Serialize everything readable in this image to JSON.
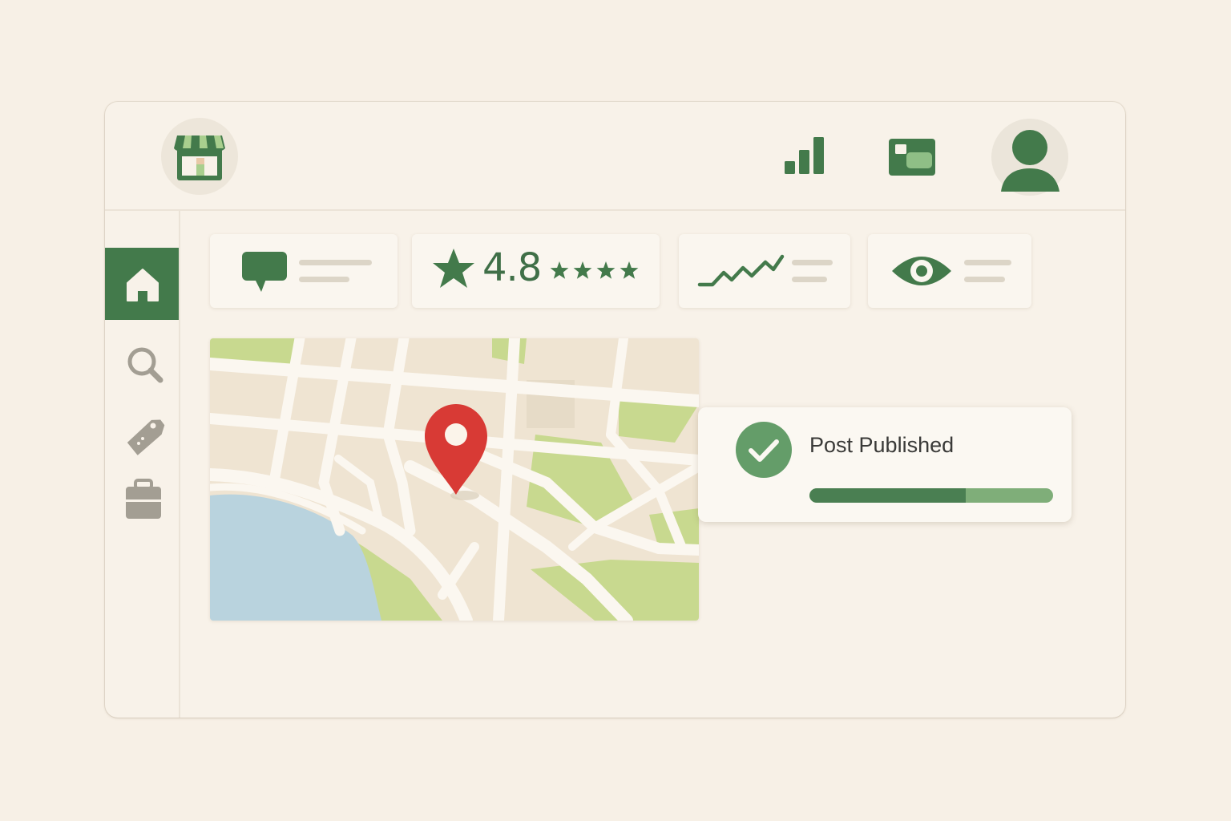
{
  "colors": {
    "accent": "#437a4b",
    "accent_light": "#7fae79",
    "background": "#f7f0e6",
    "map_pin": "#d83a35",
    "water": "#b9d3de",
    "park": "#c8d98f"
  },
  "header": {
    "logo_icon": "storefront-icon",
    "actions": [
      {
        "icon": "bar-chart-icon"
      },
      {
        "icon": "photo-card-icon"
      },
      {
        "icon": "user-avatar-icon"
      }
    ]
  },
  "sidebar": {
    "items": [
      {
        "icon": "home-icon",
        "active": true
      },
      {
        "icon": "search-icon",
        "active": false
      },
      {
        "icon": "tag-icon",
        "active": false
      },
      {
        "icon": "briefcase-icon",
        "active": false
      }
    ]
  },
  "stats": [
    {
      "icon": "speech-bubble-icon"
    },
    {
      "icon": "star-icon",
      "value": "4.8",
      "stars": 4
    },
    {
      "icon": "trend-line-icon"
    },
    {
      "icon": "eye-icon"
    }
  ],
  "map": {
    "pin_icon": "map-pin-icon"
  },
  "toast": {
    "icon": "check-circle-icon",
    "message": "Post Published",
    "progress": 0.64
  }
}
